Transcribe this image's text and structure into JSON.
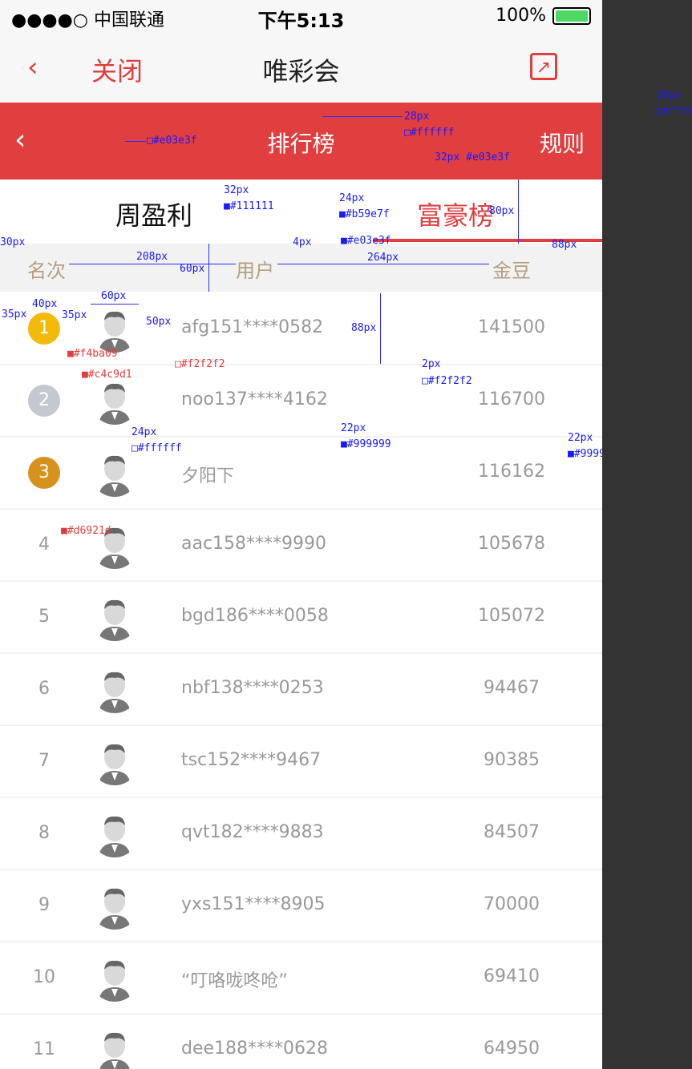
{
  "status": {
    "carrier": "●●●●○ 中国联通",
    "time": "下午5:13",
    "battery": "100%"
  },
  "nav": {
    "back_icon": "‹",
    "close": "关闭",
    "title": "唯彩会",
    "share_icon": "↗"
  },
  "redbar": {
    "back_icon": "‹",
    "title": "排行榜",
    "rules": "规则"
  },
  "tabs": [
    "周盈利",
    "富豪榜"
  ],
  "headers": {
    "rank": "名次",
    "user": "用户",
    "gold": "金豆"
  },
  "colors": {
    "red": "#e03e3f",
    "rank1": "#f4ba09",
    "rank2": "#c4c9d1",
    "rank3": "#d6921d",
    "text": "#999999",
    "header": "#b59e7f"
  },
  "rows": [
    {
      "rank": "1",
      "user": "afg151****0582",
      "gold": "141500"
    },
    {
      "rank": "2",
      "user": "noo137****4162",
      "gold": "116700"
    },
    {
      "rank": "3",
      "user": "夕阳下",
      "gold": "116162"
    },
    {
      "rank": "4",
      "user": "aac158****9990",
      "gold": "105678"
    },
    {
      "rank": "5",
      "user": "bgd186****0058",
      "gold": "105072"
    },
    {
      "rank": "6",
      "user": "nbf138****0253",
      "gold": "94467"
    },
    {
      "rank": "7",
      "user": "tsc152****9467",
      "gold": "90385"
    },
    {
      "rank": "8",
      "user": "qvt182****9883",
      "gold": "84507"
    },
    {
      "rank": "9",
      "user": "yxs151****8905",
      "gold": "70000"
    },
    {
      "rank": "10",
      "user": "“叮咯咙咚呛”",
      "gold": "69410"
    },
    {
      "rank": "11",
      "user": "dee188****0628",
      "gold": "64950"
    }
  ],
  "annotations": {
    "a1": "28px",
    "a2": "□#ffffff",
    "a3": "□#e03e3f",
    "a4": "28px",
    "a5": "□#ffffff",
    "a6": "32px #e03e3f",
    "a7": "32px",
    "a8": "■#111111",
    "a9": "24px",
    "a10": "■#b59e7f",
    "a11": "80px",
    "a12": "4px",
    "a13": "■#e03e3f",
    "a14": "88px",
    "a15": "30px",
    "a16": "208px",
    "a17": "60px",
    "a18": "264px",
    "a19": "60px",
    "a20": "40px",
    "a21": "35px",
    "a22": "35px",
    "a23": "50px",
    "a24": "■#f4ba09",
    "a25": "□#f2f2f2",
    "a26": "88px",
    "a27": "■#c4c9d1",
    "a28": "2px",
    "a29": "□#f2f2f2",
    "a30": "22px",
    "a31": "■#999999",
    "a32": "22px",
    "a33": "■#999999",
    "a34": "24px",
    "a35": "□#ffffff",
    "a36": "■#d6921d"
  }
}
